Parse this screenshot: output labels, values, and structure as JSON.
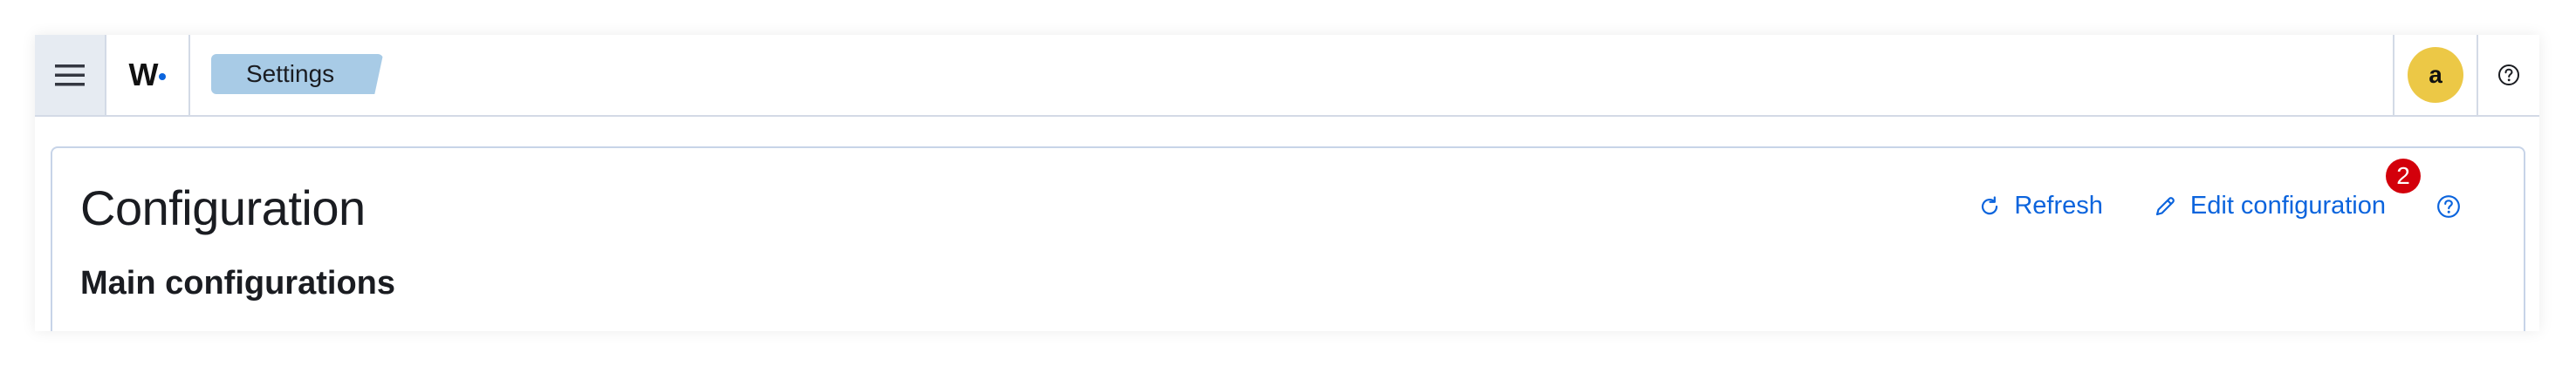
{
  "header": {
    "logo_text": "W",
    "breadcrumb_label": "Settings",
    "avatar_initial": "a"
  },
  "main": {
    "title": "Configuration",
    "section_title": "Main configurations",
    "actions": {
      "refresh_label": "Refresh",
      "edit_label": "Edit configuration",
      "edit_badge_count": "2"
    }
  },
  "icons": {
    "menu": "hamburger-icon",
    "help": "question-circle-icon",
    "refresh": "refresh-icon",
    "edit": "pencil-icon"
  },
  "colors": {
    "accent": "#0b64dd",
    "breadcrumb_bg": "#a8cbe6",
    "avatar_bg": "#ecc846",
    "badge_bg": "#d3000b"
  }
}
